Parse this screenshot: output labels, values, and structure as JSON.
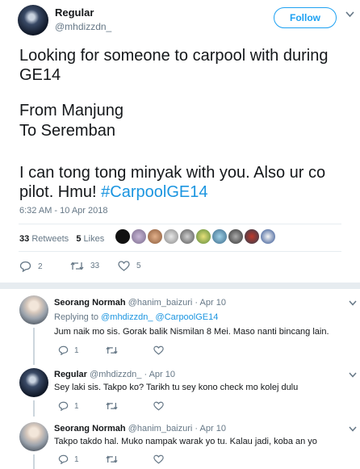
{
  "tweet": {
    "author_name": "Regular",
    "author_handle": "@mhdizzdn_",
    "follow_label": "Follow",
    "lines": [
      "Looking for someone to carpool with during",
      "GE14",
      "From Manjung",
      "To Seremban",
      "I can tong tong minyak with you. Also ur co",
      "pilot. Hmu!"
    ],
    "hashtag": "#CarpoolGE14",
    "timestamp": "6:32 AM - 10 Apr 2018",
    "retweets_count": "33",
    "retweets_label": "Retweets",
    "likes_count": "5",
    "likes_label": "Likes",
    "reply_count": "2",
    "retweet_action_count": "33",
    "like_action_count": "5"
  },
  "replies": [
    {
      "name": "Seorang Normah",
      "handle": "@hanim_baizuri",
      "date": "· Apr 10",
      "replying_to_label": "Replying to",
      "replying_to": [
        "@mhdizzdn_",
        "@CarpoolGE14"
      ],
      "text": "Jum naik mo sis. Gorak balik Nismilan 8 Mei. Maso nanti bincang lain.",
      "reply_count": "1"
    },
    {
      "name": "Regular",
      "handle": "@mhdizzdn_",
      "date": "· Apr 10",
      "text": "Sey laki sis. Takpo ko? Tarikh tu sey kono check mo kolej dulu",
      "reply_count": "1"
    },
    {
      "name": "Seorang Normah",
      "handle": "@hanim_baizuri",
      "date": "· Apr 10",
      "text": "Takpo takdo hal. Muko nampak warak yo tu. Kalau jadi, koba an yo",
      "reply_count": "1"
    }
  ],
  "colors": {
    "accent": "#1da1f2",
    "hashtag": "#1b95e0",
    "muted": "#657786"
  }
}
